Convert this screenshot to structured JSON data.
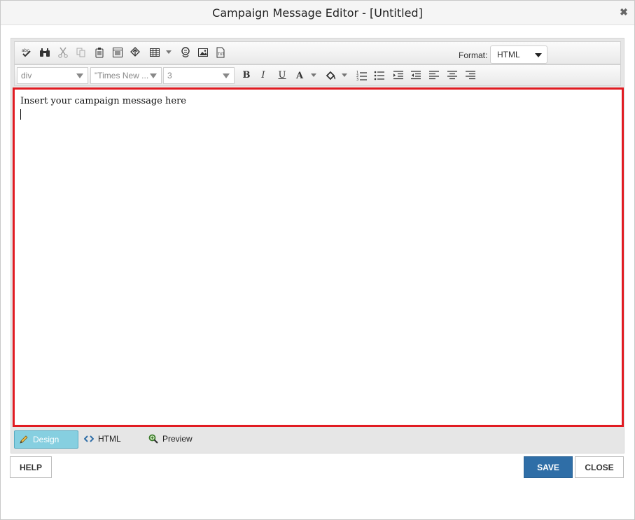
{
  "dialog": {
    "title": "Campaign Message Editor - [Untitled]",
    "close_glyph": "✖"
  },
  "toolbar": {
    "format_label": "Format:",
    "format_value": "HTML",
    "block_format": "div",
    "font_name": "\"Times New ...",
    "font_size": "3",
    "bold_label": "B",
    "italic_label": "I",
    "underline_label": "U",
    "forecolor_label": "A"
  },
  "content": {
    "text": "Insert your campaign message here"
  },
  "modes": [
    {
      "label": "Design",
      "icon": "pencil-icon",
      "active": true
    },
    {
      "label": "HTML",
      "icon": "code-icon",
      "active": false
    },
    {
      "label": "Preview",
      "icon": "magnifier-icon",
      "active": false
    }
  ],
  "footer": {
    "help_label": "HELP",
    "save_label": "SAVE",
    "close_label": "CLOSE"
  },
  "colors": {
    "accent_border": "#e11b22",
    "primary_button": "#2f6ea7",
    "active_mode": "#86cfe0"
  }
}
